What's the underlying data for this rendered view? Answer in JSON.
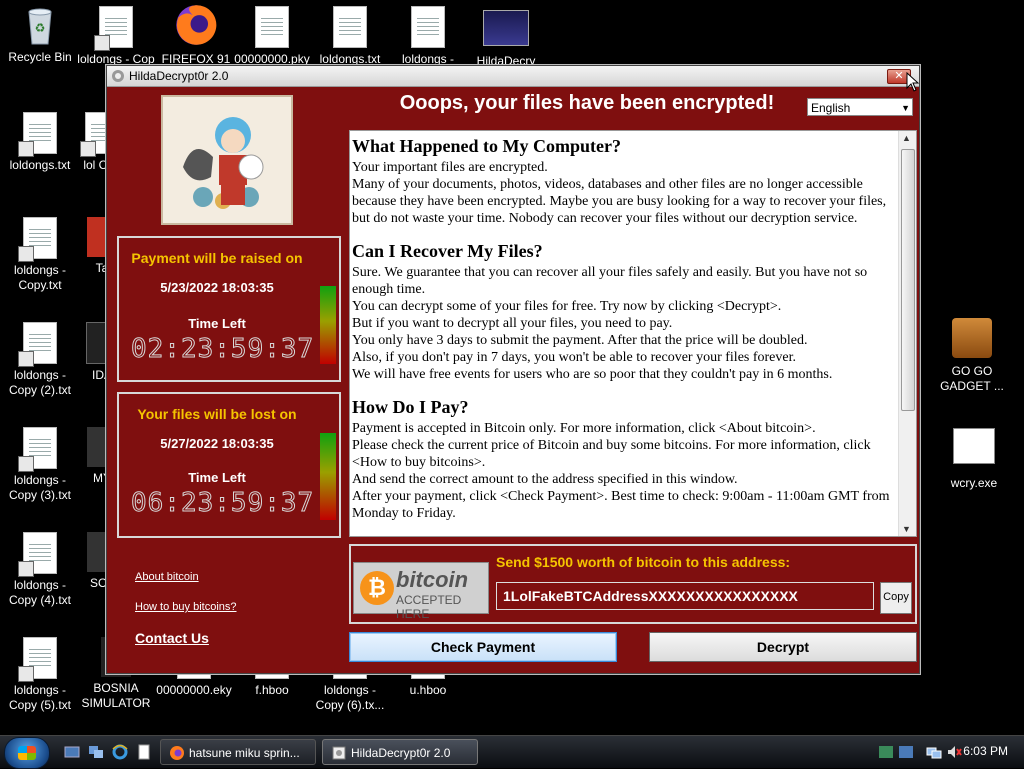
{
  "desktop": {
    "icons_top": [
      {
        "label": "Recycle Bin",
        "icon": "recycle-bin-icon"
      },
      {
        "label": "loldongs - Cop",
        "icon": "text-file-icon"
      },
      {
        "label": "FIREFOX 91",
        "icon": "firefox-icon"
      },
      {
        "label": "00000000.pky",
        "icon": "file-icon"
      },
      {
        "label": "loldongs.txt",
        "icon": "file-icon"
      },
      {
        "label": "loldongs -",
        "icon": "file-icon"
      },
      {
        "label": "HildaDecry",
        "icon": "app-icon"
      }
    ],
    "icons_left": [
      {
        "label": "loldongs.txt"
      },
      {
        "label": "loldongs - Copy.txt"
      },
      {
        "label": "loldongs - Copy (2).txt"
      },
      {
        "label": "loldongs - Copy (3).txt"
      },
      {
        "label": "loldongs - Copy (4).txt"
      },
      {
        "label": "loldongs - Copy (5).txt"
      }
    ],
    "icons_col2": [
      {
        "label": "lol Cop"
      },
      {
        "label": "Ta"
      },
      {
        "label": "IDA"
      },
      {
        "label": "MY"
      },
      {
        "label": "SO I"
      },
      {
        "label": "BOSNIA SIMULATOR"
      }
    ],
    "icons_bottom": [
      {
        "label": "00000000.eky"
      },
      {
        "label": "f.hboo"
      },
      {
        "label": "loldongs - Copy (6).tx..."
      },
      {
        "label": "u.hboo"
      }
    ],
    "icons_right": [
      {
        "label": "GO GO GADGET ..."
      },
      {
        "label": "wcry.exe"
      }
    ]
  },
  "window": {
    "title": "HildaDecrypt0r 2.0",
    "close_label": "✕",
    "heading": "Ooops, your files have been encrypted!",
    "language": "English",
    "panel1": {
      "title": "Payment will be raised on",
      "date": "5/23/2022 18:03:35",
      "time_left_label": "Time Left",
      "countdown": "02:23:59:37",
      "bar_level": 0.85
    },
    "panel2": {
      "title": "Your files will be lost on",
      "date": "5/27/2022 18:03:35",
      "time_left_label": "Time Left",
      "countdown": "06:23:59:37",
      "bar_level": 0.95
    },
    "links": {
      "about_bitcoin": "About bitcoin",
      "how_to_buy": "How to buy bitcoins?",
      "contact": "Contact Us"
    },
    "content": {
      "s1_title": "What Happened to My Computer?",
      "s1_p1": "Your important files are encrypted.",
      "s1_p2": "Many of your documents, photos, videos, databases and other files are no longer accessible because they have been encrypted. Maybe you are busy looking for a way to recover your files, but do not waste your time. Nobody can recover your files without our decryption service.",
      "s2_title": "Can I Recover My Files?",
      "s2_p1": "Sure. We guarantee that you can recover all your files safely and easily. But you have not so enough time.",
      "s2_p2": "You can decrypt some of your files for free. Try now by clicking <Decrypt>.",
      "s2_p3": "But if you want to decrypt all your files, you need to pay.",
      "s2_p4": "You only have 3 days to submit the payment. After that the price will be doubled.",
      "s2_p5": "Also, if you don't pay in 7 days, you won't be able to recover your files forever.",
      "s2_p6": "We will have free events for users who are so poor that they couldn't pay in 6 months.",
      "s3_title": "How Do I Pay?",
      "s3_p1": "Payment is accepted in Bitcoin only. For more information, click <About bitcoin>.",
      "s3_p2": "Please check the current price of Bitcoin and buy some bitcoins. For more information, click <How to buy bitcoins>.",
      "s3_p3": "And send the correct amount to the address specified in this window.",
      "s3_p4": "After your payment, click <Check Payment>. Best time to check: 9:00am - 11:00am GMT from Monday to Friday."
    },
    "bitcoin": {
      "logo_word": "bitcoin",
      "logo_sub": "ACCEPTED HERE",
      "send_label": "Send $1500 worth of bitcoin to this address:",
      "address": "1LolFakeBTCAddressXXXXXXXXXXXXXXXX",
      "copy_label": "Copy"
    },
    "buttons": {
      "check_payment": "Check Payment",
      "decrypt": "Decrypt"
    }
  },
  "taskbar": {
    "tasks": [
      {
        "label": "hatsune miku sprin..."
      },
      {
        "label": "HildaDecrypt0r 2.0"
      }
    ],
    "clock": "6:03 PM"
  },
  "colors": {
    "window_bg": "#7f0f0f",
    "accent_yellow": "#f5c400"
  }
}
